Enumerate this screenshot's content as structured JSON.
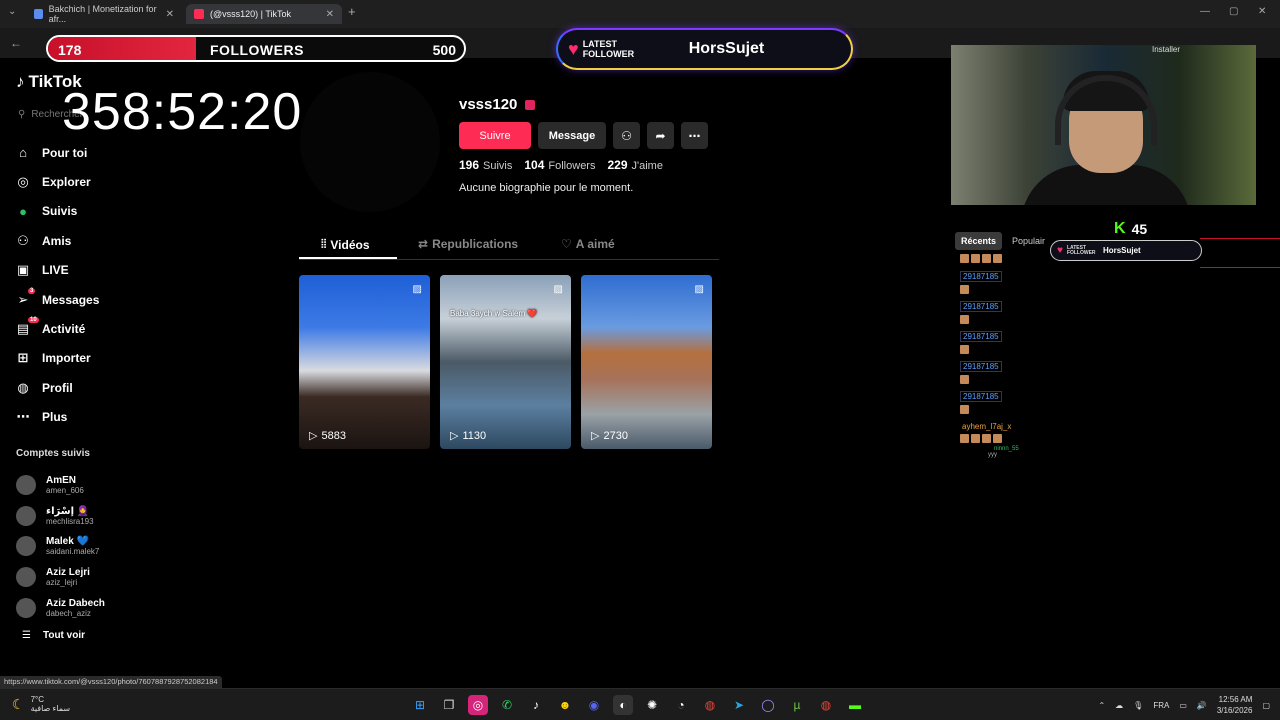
{
  "browser": {
    "tabs": [
      {
        "title": "Bakchich | Monetization for afr..."
      },
      {
        "title": "(@vsss120) | TikTok"
      }
    ],
    "status_url": "https://www.tiktok.com/@vsss120/photo/7607887928752082184"
  },
  "overlay": {
    "followers_count": "178",
    "followers_label": "FOLLOWERS",
    "followers_goal": "500",
    "followers_progress": 0.356,
    "latest_label": "LATEST FOLLOWER",
    "latest_name": "HorsSujet",
    "timer": "358:52:20",
    "kick_viewers": "45"
  },
  "tiktok": {
    "logo": "TikTok",
    "search_placeholder": "Rechercher",
    "nav": [
      {
        "label": "Pour toi",
        "icon": "home-icon"
      },
      {
        "label": "Explorer",
        "icon": "compass-icon"
      },
      {
        "label": "Suivis",
        "icon": "following-icon"
      },
      {
        "label": "Amis",
        "icon": "friends-icon"
      },
      {
        "label": "LIVE",
        "icon": "live-icon"
      },
      {
        "label": "Messages",
        "icon": "messages-icon",
        "badge": "3"
      },
      {
        "label": "Activité",
        "icon": "activity-icon",
        "badge": "10"
      },
      {
        "label": "Importer",
        "icon": "upload-icon"
      },
      {
        "label": "Profil",
        "icon": "profile-icon"
      },
      {
        "label": "Plus",
        "icon": "more-icon"
      }
    ],
    "following_title": "Comptes suivis",
    "following": [
      {
        "name": "AmEN",
        "handle": "amen_606"
      },
      {
        "name": "إسْرَاء 🧕",
        "handle": "mechlisra193"
      },
      {
        "name": "Malek 💙",
        "handle": "saidani.malek7"
      },
      {
        "name": "Aziz Lejri",
        "handle": "aziz_lejri"
      },
      {
        "name": "Aziz Dabech",
        "handle": "dabech_aziz"
      }
    ],
    "see_all": "Tout voir"
  },
  "profile": {
    "username": "vsss120",
    "follow_btn": "Suivre",
    "message_btn": "Message",
    "following_count": "196",
    "following_label": "Suivis",
    "followers_count": "104",
    "followers_label": "Followers",
    "likes_count": "229",
    "likes_label": "J'aime",
    "bio": "Aucune biographie pour le moment.",
    "tabs": [
      "Vidéos",
      "Republications",
      "A aimé"
    ],
    "videos": [
      {
        "views": "5883",
        "caption": ""
      },
      {
        "views": "1130",
        "caption": "Baba 3aych w Salem ❤️"
      },
      {
        "views": "2730",
        "caption": ""
      }
    ]
  },
  "stream": {
    "install_label": "Installer",
    "chat_tabs": [
      "Récents",
      "Populair"
    ],
    "mini_latest_label": "LATEST FOLLOWER",
    "mini_latest_name": "HorsSujet",
    "chat": [
      {
        "user": "29187185"
      },
      {
        "user": "29187185"
      },
      {
        "user": "29187185"
      },
      {
        "user": "29187185"
      },
      {
        "user": "29187185"
      },
      {
        "user": "ayhem_l7aj_x"
      }
    ],
    "chat_small_user": "ninnn_55",
    "chat_small_text": "yyy"
  },
  "taskbar": {
    "temp": "7°C",
    "weather_text": "سماء صافية",
    "lang": "FRA",
    "time": "12:56 AM",
    "date": "3/16/2026"
  },
  "colors": {
    "accent": "#fe2c55",
    "kick": "#53fc18",
    "overlay_red": "#c7102a"
  }
}
